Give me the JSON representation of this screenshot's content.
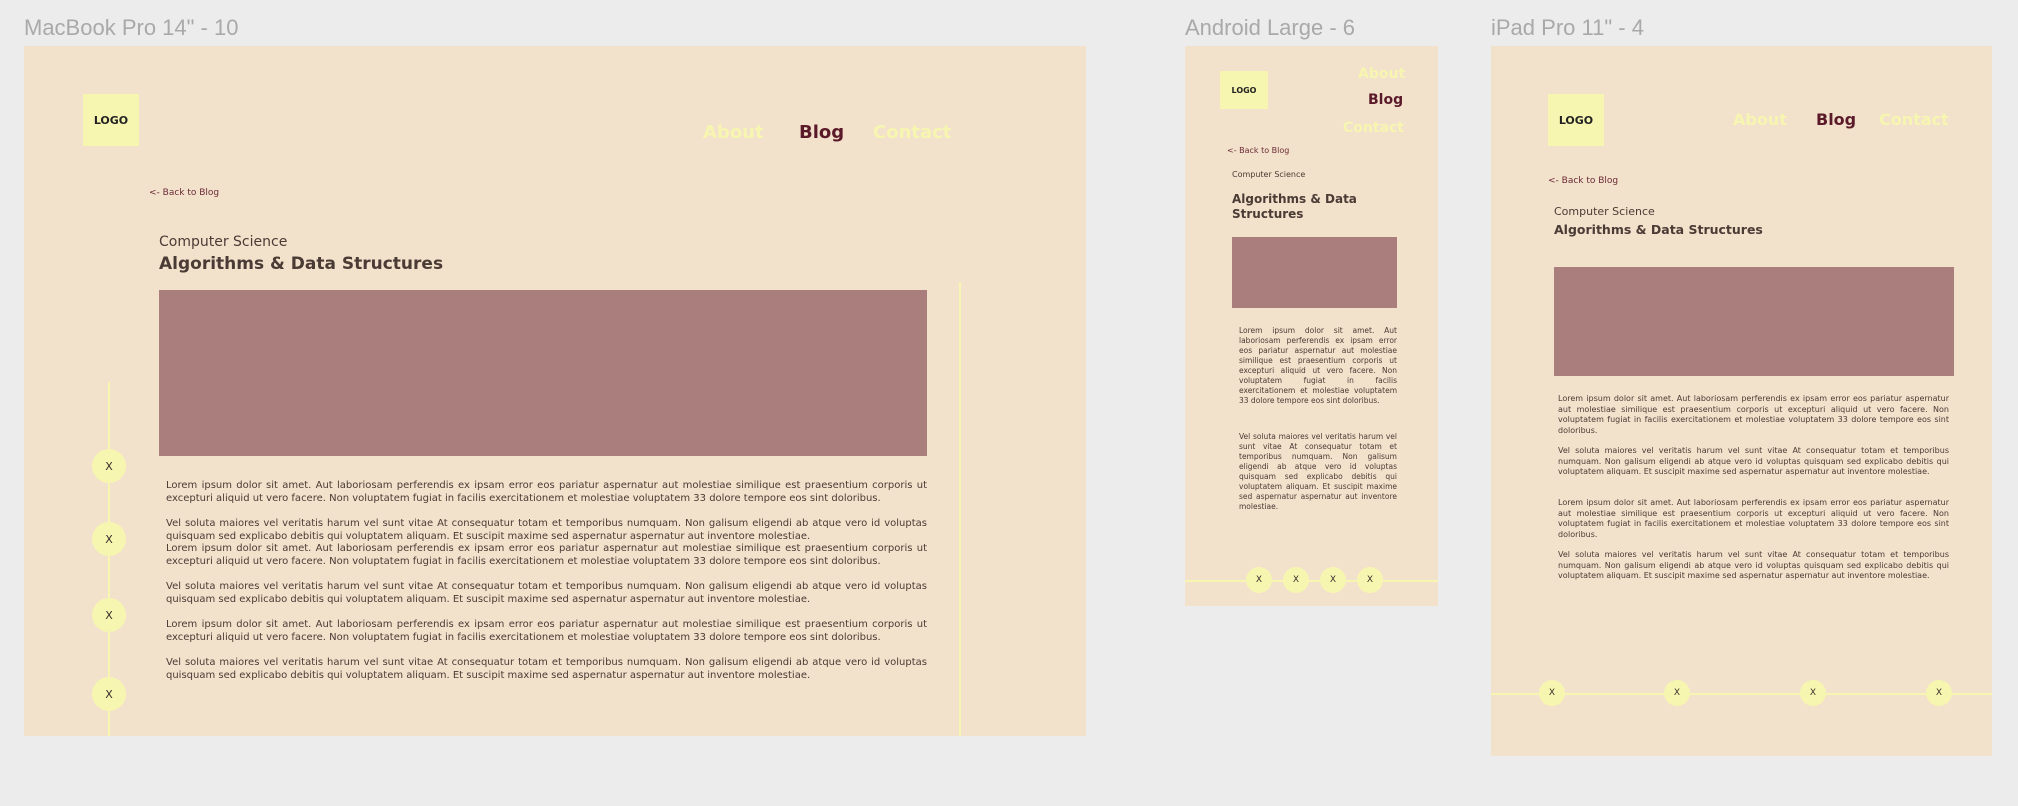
{
  "frames": {
    "macbook": {
      "title": "MacBook Pro 14\" - 10"
    },
    "android": {
      "title": "Android Large - 6"
    },
    "ipad": {
      "title": "iPad Pro 11\" - 4"
    }
  },
  "nav": {
    "logo": "LOGO",
    "about": "About",
    "blog": "Blog",
    "contact": "Contact"
  },
  "article": {
    "back": "<- Back to Blog",
    "category": "Computer Science",
    "title": "Algorithms & Data Structures",
    "p1": "Lorem ipsum dolor sit amet. Aut laboriosam perferendis ex ipsam error eos pariatur aspernatur aut molestiae similique est praesentium corporis ut excepturi aliquid ut vero facere. Non voluptatem fugiat in facilis exercitationem et molestiae voluptatem 33 dolore tempore eos sint doloribus.",
    "p2": "Vel soluta maiores vel veritatis harum vel sunt vitae At consequatur totam et temporibus numquam. Non galisum eligendi ab atque vero id voluptas quisquam sed explicabo debitis qui voluptatem aliquam. Et suscipit maxime sed aspernatur aspernatur aut inventore molestiae."
  },
  "social": {
    "x_label": "X"
  },
  "colors": {
    "page_bg": "#ececec",
    "frame_bg": "#f2e1cb",
    "accent": "#f7f6b0",
    "active": "#5b1a2a",
    "hero": "#a97e7c",
    "text": "#4a3b35"
  }
}
